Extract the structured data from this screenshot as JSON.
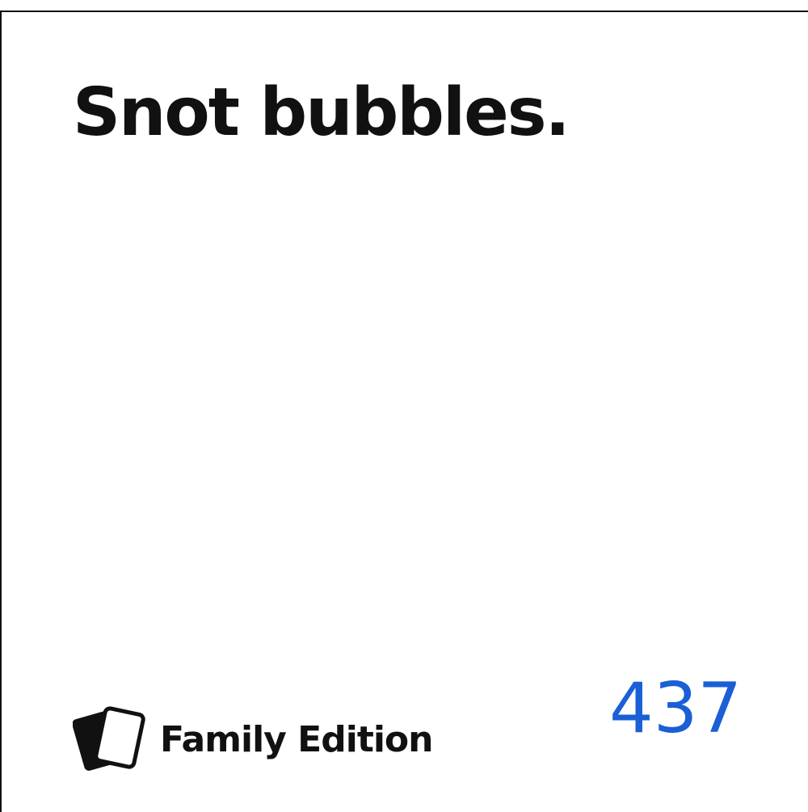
{
  "card": {
    "text": "Snot bubbles.",
    "edition_label": "Family Edition",
    "number": "437",
    "logo_icon": "stacked-cards-icon",
    "colors": {
      "text": "#111111",
      "number": "#1a5fd6",
      "background": "#ffffff"
    }
  }
}
